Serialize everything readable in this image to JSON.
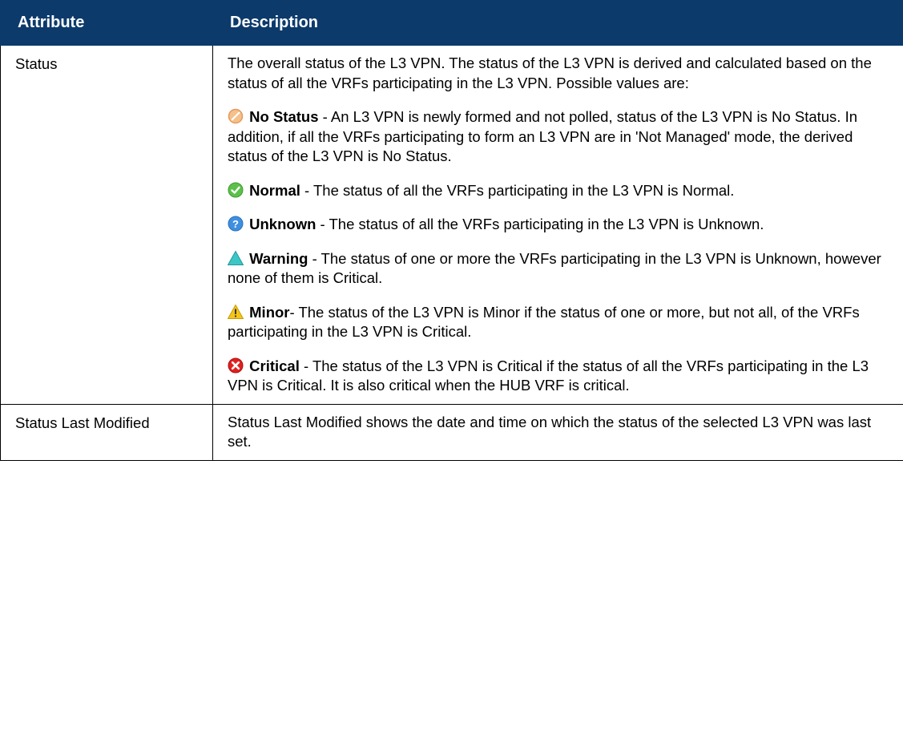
{
  "header": {
    "col_attribute": "Attribute",
    "col_description": "Description"
  },
  "rows": [
    {
      "attribute": "Status",
      "intro": "The overall status of the L3 VPN. The status of the L3 VPN is derived and calculated based on the status of all the VRFs participating in the L3 VPN. Possible values are:",
      "statuses": [
        {
          "icon": "no-status-icon",
          "name": "No Status",
          "text": " - An L3 VPN is newly formed and not polled, status of the L3 VPN is No Status. In addition, if all the VRFs participating to form an L3 VPN are in 'Not Managed' mode, the derived status of the L3 VPN is No Status."
        },
        {
          "icon": "normal-icon",
          "name": "Normal",
          "text": " - The status of all the VRFs participating in the L3 VPN is Normal."
        },
        {
          "icon": "unknown-icon",
          "name": "Unknown",
          "text": " - The status of all the VRFs participating in the L3 VPN is Unknown."
        },
        {
          "icon": "warning-icon",
          "name": "Warning",
          "text": " - The status of one or more the VRFs participating in the L3 VPN is Unknown, however none of them is Critical."
        },
        {
          "icon": "minor-icon",
          "name": "Minor",
          "text": "- The status of the L3 VPN is Minor if the status of one or more, but not all, of the VRFs participating in the L3 VPN is Critical."
        },
        {
          "icon": "critical-icon",
          "name": "Critical",
          "text": " - The status of the L3 VPN is Critical if the status of all the VRFs participating in the L3 VPN is Critical. It is also critical when the HUB VRF is critical."
        }
      ]
    },
    {
      "attribute": "Status Last Modified",
      "description": "Status Last Modified shows the date and time on which the status of the selected L3 VPN was last set."
    }
  ],
  "colors": {
    "header_bg": "#0c3a6b",
    "header_text": "#ffffff",
    "border": "#000000"
  }
}
